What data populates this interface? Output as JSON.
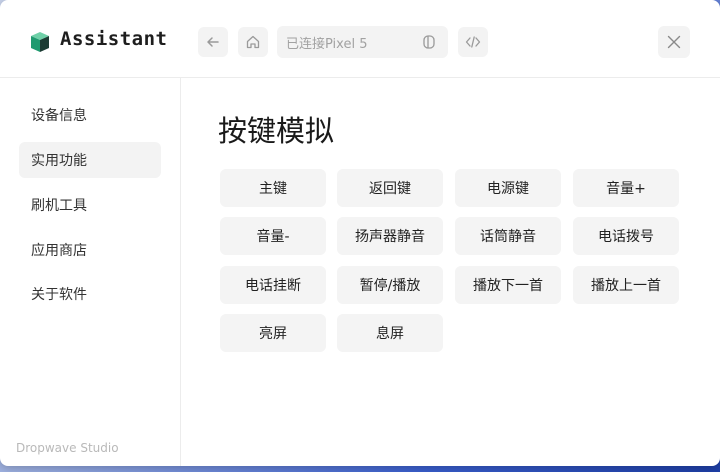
{
  "app": {
    "name": "Assistant",
    "footer": "Dropwave Studio"
  },
  "toolbar": {
    "device_label": "已连接Pixel 5",
    "icons": [
      "back-arrow-icon",
      "home-icon",
      "device-mode-icon",
      "code-icon",
      "close-icon"
    ]
  },
  "sidebar": {
    "items": [
      {
        "label": "设备信息"
      },
      {
        "label": "实用功能",
        "active": true
      },
      {
        "label": "刷机工具"
      },
      {
        "label": "应用商店"
      },
      {
        "label": "关于软件"
      }
    ]
  },
  "main": {
    "title": "按键模拟",
    "keys": [
      "主键",
      "返回键",
      "电源键",
      "音量+",
      "音量-",
      "扬声器静音",
      "话筒静音",
      "电话拨号",
      "电话挂断",
      "暂停/播放",
      "播放下一首",
      "播放上一首",
      "亮屏",
      "息屏"
    ]
  },
  "colors": {
    "accent_surface": "#f3f3f3",
    "logo_green": "#1f9a6f",
    "logo_dark": "#1b3b33"
  }
}
